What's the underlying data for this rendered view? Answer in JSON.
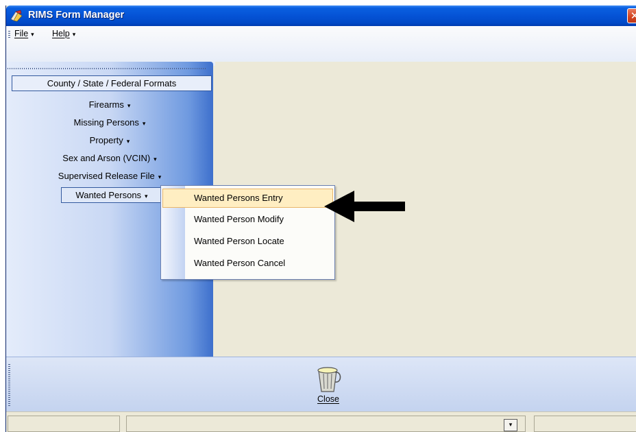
{
  "window": {
    "title": "RIMS Form Manager",
    "close_glyph": "✕"
  },
  "menu": {
    "file": "File",
    "help": "Help",
    "caret": "▾"
  },
  "panel": {
    "header": "County / State / Federal Formats",
    "items": [
      {
        "label": "Firearms",
        "caret": "▾"
      },
      {
        "label": "Missing Persons",
        "caret": "▾"
      },
      {
        "label": "Property",
        "caret": "▾"
      },
      {
        "label": "Sex and Arson (VCIN)",
        "caret": "▾"
      },
      {
        "label": "Supervised Release File",
        "caret": "▾"
      },
      {
        "label": "Wanted Persons",
        "caret": "▾"
      }
    ]
  },
  "submenu": {
    "items": [
      {
        "label": "Wanted Persons Entry",
        "highlighted": true
      },
      {
        "label": "Wanted Person Modify"
      },
      {
        "label": "Wanted Person Locate"
      },
      {
        "label": "Wanted Person Cancel"
      }
    ]
  },
  "toolbar": {
    "close_label": "Close",
    "close_icon": "trash-can-icon"
  },
  "statusbar": {
    "dropdown_glyph": "▾"
  },
  "colors": {
    "titlebar": "#0553d6",
    "highlight": "#ffeec2",
    "highlight_border": "#e8b56a",
    "panel_border": "#31589e"
  }
}
